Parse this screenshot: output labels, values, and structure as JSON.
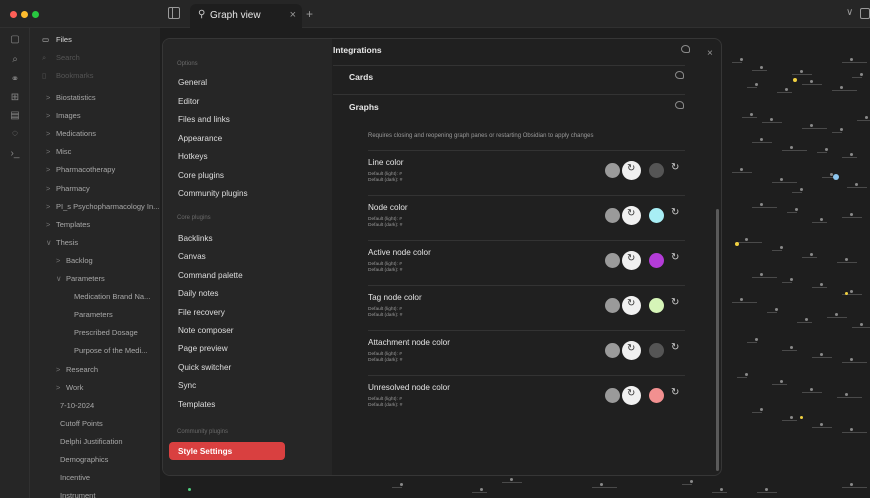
{
  "window": {
    "tab_label": "Graph view",
    "tab_close": "×",
    "tab_new": "+"
  },
  "explorer": {
    "files_label": "Files",
    "search_label": "Search",
    "bookmarks_label": "Bookmarks",
    "items": [
      {
        "label": "Biostatistics",
        "chevron": ">"
      },
      {
        "label": "Images",
        "chevron": ">"
      },
      {
        "label": "Medications",
        "chevron": ">"
      },
      {
        "label": "Misc",
        "chevron": ">"
      },
      {
        "label": "Pharmacotherapy",
        "chevron": ">"
      },
      {
        "label": "Pharmacy",
        "chevron": ">"
      },
      {
        "label": "PI_s Psychopharmacology In...",
        "chevron": ">"
      },
      {
        "label": "Templates",
        "chevron": ">"
      },
      {
        "label": "Thesis",
        "chevron": "∨"
      },
      {
        "label": "Backlog",
        "chevron": ">"
      },
      {
        "label": "Parameters",
        "chevron": "∨"
      },
      {
        "label": "Medication Brand Na...",
        "chevron": ""
      },
      {
        "label": "Parameters",
        "chevron": ""
      },
      {
        "label": "Prescribed Dosage",
        "chevron": ""
      },
      {
        "label": "Purpose of the Medi...",
        "chevron": ""
      },
      {
        "label": "Research",
        "chevron": ">"
      },
      {
        "label": "Work",
        "chevron": ">"
      },
      {
        "label": "7-10-2024",
        "chevron": ""
      },
      {
        "label": "Cutoff Points",
        "chevron": ""
      },
      {
        "label": "Delphi Justification",
        "chevron": ""
      },
      {
        "label": "Demographics",
        "chevron": ""
      },
      {
        "label": "Incentive",
        "chevron": ""
      },
      {
        "label": "Instrument",
        "chevron": ""
      }
    ]
  },
  "settings": {
    "options_heading": "Options",
    "options": [
      "General",
      "Editor",
      "Files and links",
      "Appearance",
      "Hotkeys",
      "Core plugins",
      "Community plugins"
    ],
    "core_heading": "Core plugins",
    "core": [
      "Backlinks",
      "Canvas",
      "Command palette",
      "Daily notes",
      "File recovery",
      "Note composer",
      "Page preview",
      "Quick switcher",
      "Sync",
      "Templates"
    ],
    "community_heading": "Community plugins",
    "community": [
      "Style Settings"
    ],
    "close": "×"
  },
  "content": {
    "sections": [
      "Integrations",
      "Cards",
      "Graphs"
    ],
    "notice": "Requires closing and reopening graph panes or restarting Obsidian to apply changes",
    "settings": [
      {
        "name": "Line color",
        "def_light": "Default (light): #",
        "def_dark": "Default (dark): #",
        "color": "#555555"
      },
      {
        "name": "Node color",
        "def_light": "Default (light): #",
        "def_dark": "Default (dark): #",
        "color": "#a8eef5"
      },
      {
        "name": "Active node color",
        "def_light": "Default (light): #",
        "def_dark": "Default (dark): #",
        "color": "#b43cd8"
      },
      {
        "name": "Tag node color",
        "def_light": "Default (light): #",
        "def_dark": "Default (dark): #",
        "color": "#d6f5b8"
      },
      {
        "name": "Attachment node color",
        "def_light": "Default (light): #",
        "def_dark": "Default (dark): #",
        "color": "#555555"
      },
      {
        "name": "Unresolved node color",
        "def_light": "Default (light): #",
        "def_dark": "Default (dark): #",
        "color": "#f29090"
      }
    ]
  },
  "colors": {
    "accent": "#d94040",
    "background": "#1e1e1e",
    "panel": "#262626"
  }
}
